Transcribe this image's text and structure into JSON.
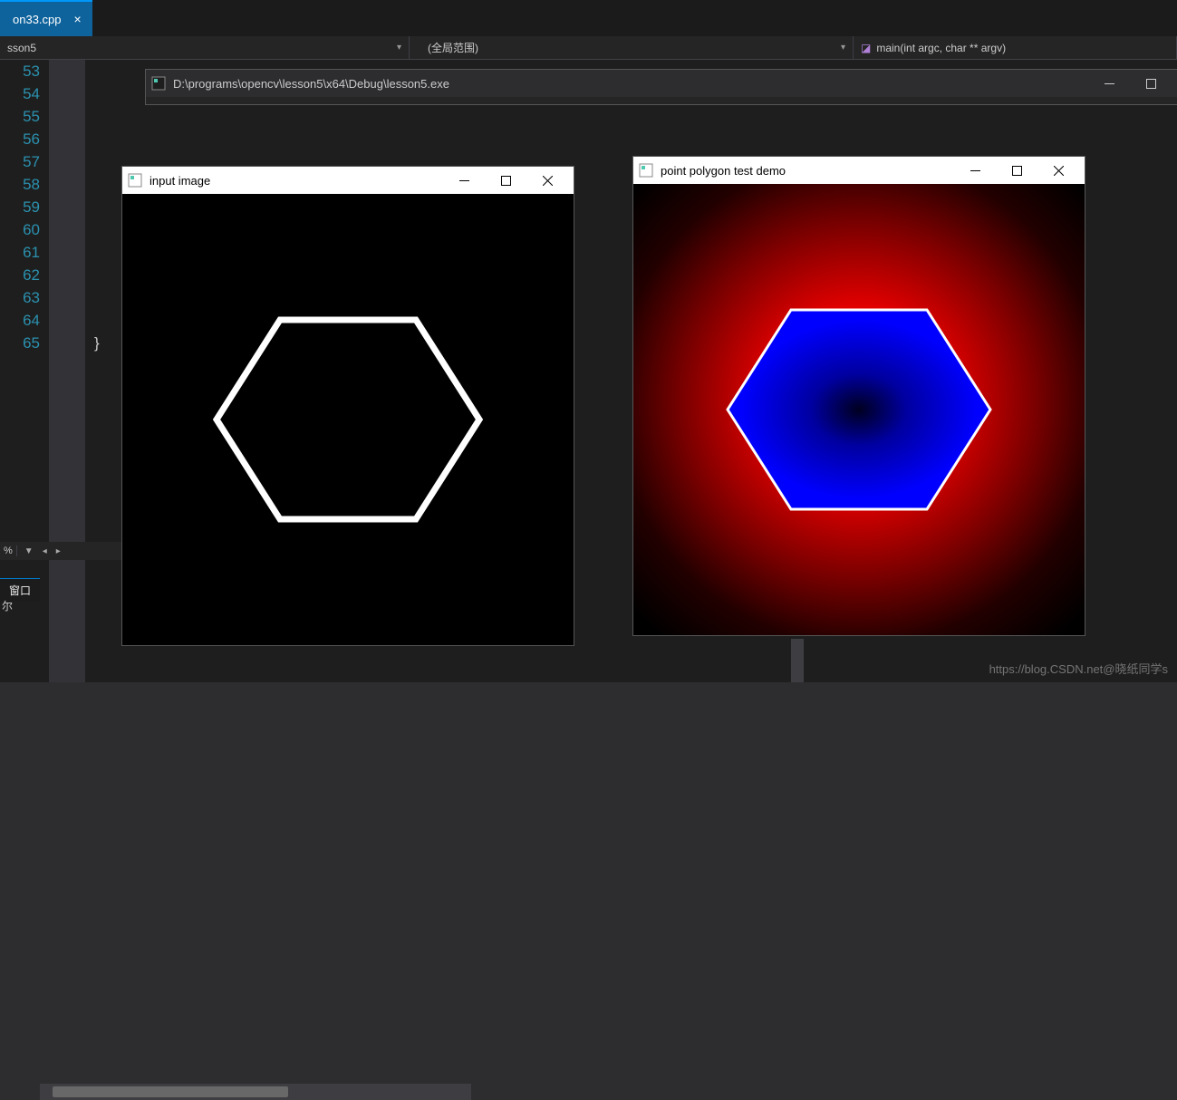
{
  "tab": {
    "label": "on33.cpp",
    "close": "×"
  },
  "context": {
    "left": "sson5",
    "mid": "(全局范围)",
    "right": "main(int argc, char ** argv)"
  },
  "gutter": [
    "53",
    "54",
    "55",
    "56",
    "57",
    "58",
    "59",
    "60",
    "61",
    "62",
    "63",
    "64",
    "65"
  ],
  "code": {
    "brace": "}"
  },
  "bottom": {
    "pct": "%",
    "arrow": "▼",
    "panel_tab": "窗口",
    "panel_row": "尔"
  },
  "console": {
    "title": "D:\\programs\\opencv\\lesson5\\x64\\Debug\\lesson5.exe"
  },
  "win_input": {
    "title": "input image"
  },
  "win_result": {
    "title": "point polygon test demo"
  },
  "watermark": "https://blog.CSDN.net@晓纸同学s"
}
